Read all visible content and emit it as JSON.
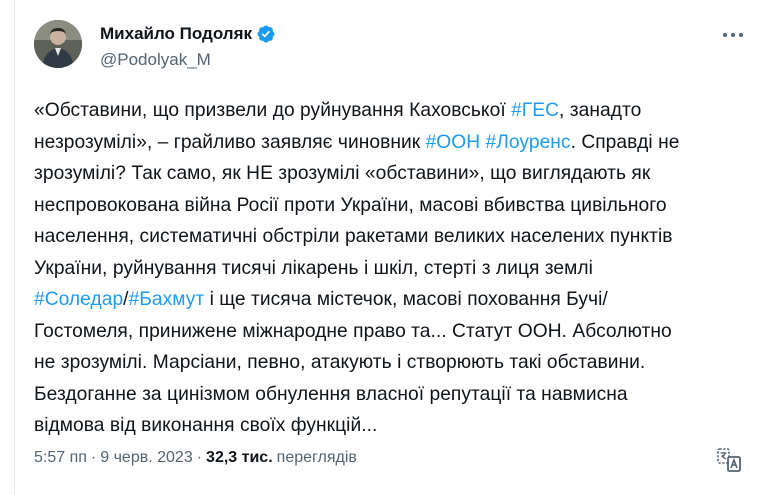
{
  "author": {
    "name": "Михайло Подоляк",
    "handle": "@Podolyak_M"
  },
  "icons": {
    "verified": "verified-badge-icon",
    "more": "more-horizontal-icon",
    "translate": "translate-icon",
    "accent": "#1d9bf0"
  },
  "tweet": {
    "l1": {
      "a": "«Обставини, що призвели до руйнування Каховської ",
      "tag1": "#ГЕС",
      "b": ", занадто"
    },
    "l2": {
      "a": "незрозумілі», – грайливо заявляє чиновник ",
      "tag1": "#ООН",
      "sp": " ",
      "tag2": "#Лоуренс",
      "b": ". Справді не"
    },
    "l3": "зрозумілі? Так само, як НЕ зрозумілі «обставини», що виглядають як",
    "l4": "неспровокована війна Росії проти України, масові вбивства цивільного",
    "l5": "населення, систематичні обстріли ракетами великих населених пунктів",
    "l6": "України, руйнування тисячі лікарень і шкіл, стерті з лиця землі",
    "l7": {
      "tag1": "#Соледар",
      "sep": "/",
      "tag2": "#Бахмут",
      "b": " і ще тисяча містечок, масові поховання Бучі/"
    },
    "l8": "Гостомеля, принижене міжнародне право та... Статут ООН. Абсолютно",
    "l9": "не зрозумілі. Марсіани, певно, атакують і створюють такі обставини.",
    "l10": "Бездоганне за цинізмом обнулення власної репутації та навмисна",
    "l11": "відмова від виконання своїх функцій..."
  },
  "meta": {
    "time": "5:57 пп",
    "dot1": "·",
    "date": "9 черв. 2023",
    "dot2": "·",
    "views": "32,3 тис.",
    "views_label": "переглядів"
  }
}
